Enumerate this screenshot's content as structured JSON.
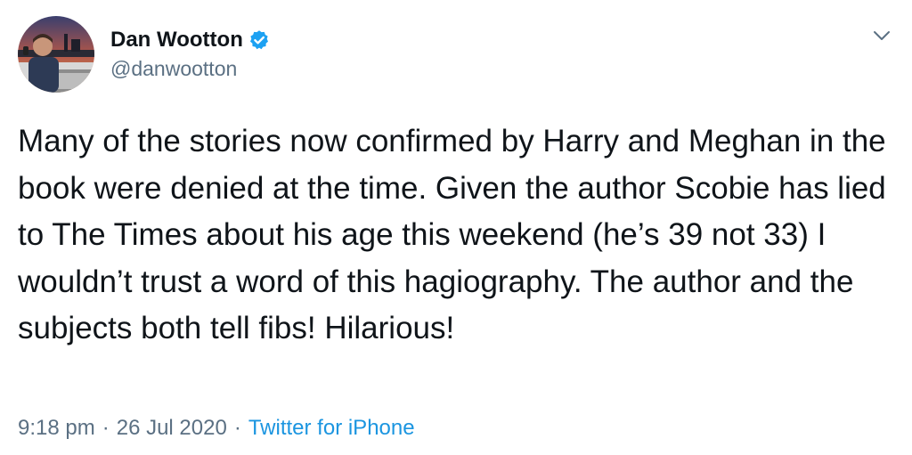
{
  "author": {
    "display_name": "Dan Wootton",
    "handle": "@danwootton",
    "verified": true
  },
  "tweet": {
    "text": "Many of the stories now confirmed by Harry and Meghan in the book were denied at the time. Given the author Scobie has lied to The Times about his age this weekend (he’s 39 not 33) I wouldn’t trust a word of this hagiography. The author and the subjects both tell fibs! Hilarious!"
  },
  "meta": {
    "time": "9:18 pm",
    "date": "26 Jul 2020",
    "separator": "·",
    "source": "Twitter for iPhone"
  },
  "icons": {
    "verified": "verified-badge-icon",
    "more": "chevron-down-icon"
  },
  "colors": {
    "accent": "#1b95e0",
    "verified": "#1da1f2",
    "secondary_text": "#5b7083"
  }
}
